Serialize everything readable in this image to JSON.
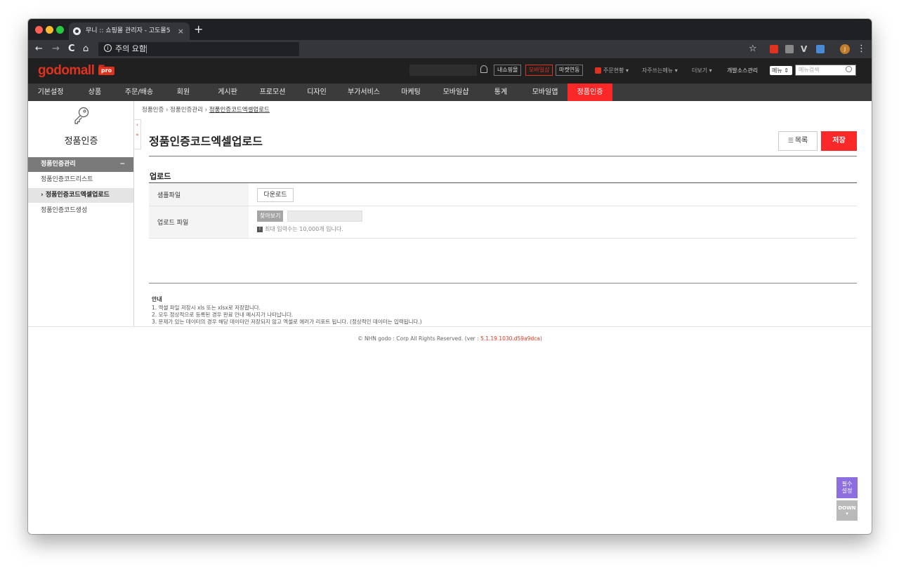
{
  "browser": {
    "tab_title": "무니 :: 쇼핑몰 관리자 - 고도몰5",
    "tab_close": "×",
    "new_tab": "+",
    "security_label": "주의 요함",
    "back": "←",
    "forward": "→",
    "reload": "C",
    "home": "⌂",
    "bookmark_star": "☆",
    "menu": "⋮",
    "profile_initial": "J"
  },
  "admin_header": {
    "logo": "godomall 5",
    "logo_badge": "pro",
    "my_shop": "내쇼핑몰",
    "mobile_shop": "모바일샵",
    "marketing_link": "마켓연동",
    "order_status": "주문현황 ▾",
    "favorite_menu": "자주쓰는메뉴 ▾",
    "more": "더보기 ▾",
    "dev_source": "개발소스관리",
    "menu_select": "메뉴 ⇕",
    "menu_search_placeholder": "메뉴검색"
  },
  "gnb": [
    {
      "label": "기본설정"
    },
    {
      "label": "상품"
    },
    {
      "label": "주문/배송"
    },
    {
      "label": "회원"
    },
    {
      "label": "게시판"
    },
    {
      "label": "프로모션"
    },
    {
      "label": "디자인"
    },
    {
      "label": "부가서비스"
    },
    {
      "label": "마케팅"
    },
    {
      "label": "모바일샵"
    },
    {
      "label": "통계"
    },
    {
      "label": "모바일앱"
    },
    {
      "label": "정품인증"
    }
  ],
  "sidebar": {
    "title": "정품인증",
    "group_title": "정품인증관리",
    "group_toggle": "−",
    "items": [
      {
        "label": "정품인증코드리스트"
      },
      {
        "label": "› 정품인증코드엑셀업로드"
      },
      {
        "label": "정품인증코드생성"
      }
    ],
    "collapse_arrows": [
      "‹",
      "«"
    ]
  },
  "breadcrumb": {
    "level1": "정품인증",
    "sep": "›",
    "level2": "정품인증관리",
    "level3": "정품인증코드엑셀업로드"
  },
  "page": {
    "title": "정품인증코드엑셀업로드",
    "list_button": "목록",
    "list_icon": "☰",
    "save_button": "저장"
  },
  "upload_section": {
    "title": "업로드",
    "sample_label": "샘플파일",
    "download_button": "다운로드",
    "upload_label": "업로드 파일",
    "browse_button": "찾아보기",
    "notice_icon": "!",
    "notice": "최대 입력수는 10,000개 입니다."
  },
  "guide": {
    "title": "안내",
    "lines": [
      "1. 엑셀 파일 저장시 xls 또는 xlsx로 저장합니다.",
      "2. 모두 정상적으로 등록된 경우 완료 안내 메시지가 나타납니다.",
      "3. 문제가 있는 데이터의 경우 해당 데이터만 저장되지 않고 엑셀로 에러가 리포트 됩니다. (정상적인 데이터는 입력됩니다.)"
    ]
  },
  "footer": {
    "copyright": "© NHN godo : Corp All Rights Reserved. (ver : ",
    "version": "5.1.19.1030.d59a9dca",
    "close": ")"
  },
  "floating": {
    "required_line1": "필수",
    "required_line2": "설정",
    "down": "DOWN",
    "down_arrow": "▾"
  },
  "colors": {
    "accent_red": "#fa2828",
    "required_purple": "#8c6ee0"
  }
}
